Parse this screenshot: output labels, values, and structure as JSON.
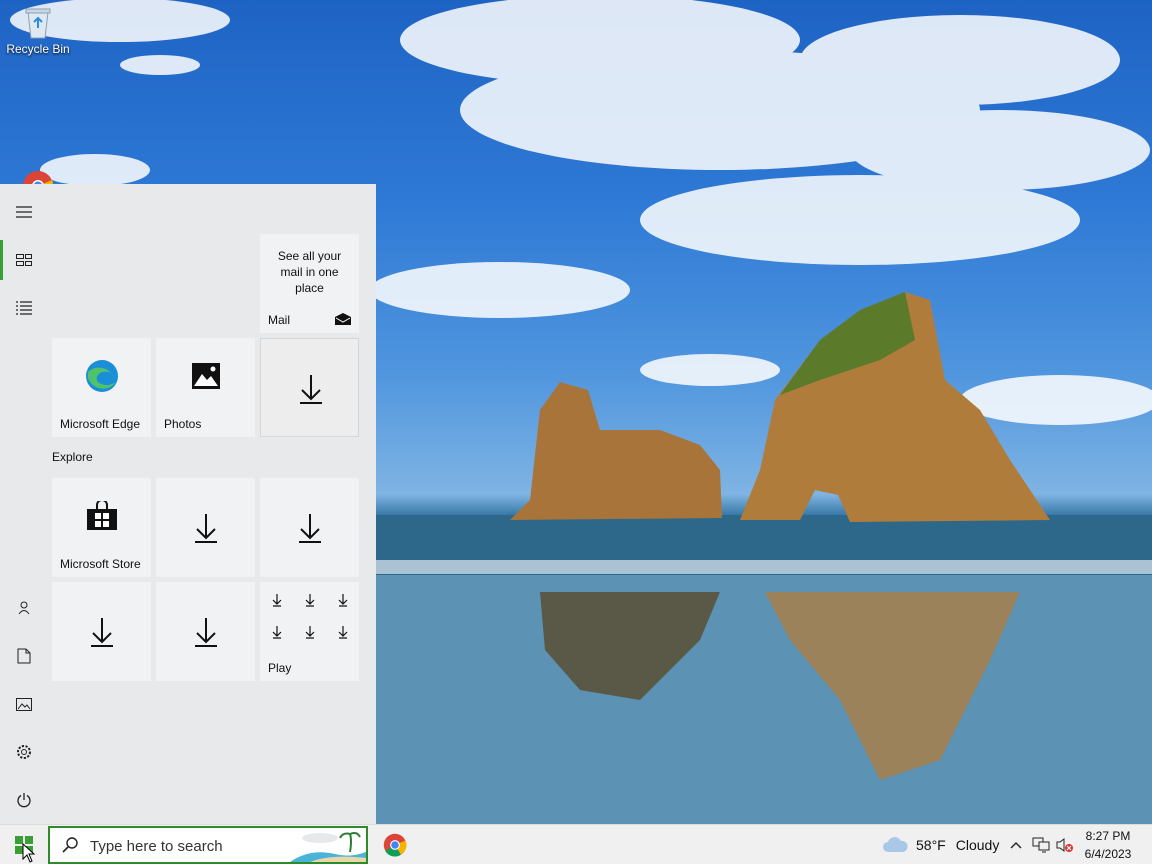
{
  "desktop": {
    "icons": [
      {
        "label": "Recycle Bin"
      }
    ]
  },
  "start_menu": {
    "tiles": {
      "mail": {
        "text": "See all your mail in one place",
        "label": "Mail"
      },
      "edge": {
        "label": "Microsoft Edge"
      },
      "photos": {
        "label": "Photos"
      },
      "store": {
        "label": "Microsoft Store"
      },
      "play": {
        "label": "Play"
      }
    },
    "group_label": "Explore"
  },
  "taskbar": {
    "search": {
      "placeholder": "Type here to search"
    },
    "weather": {
      "temp": "58°F",
      "condition": "Cloudy"
    },
    "clock": {
      "time": "8:27 PM",
      "date": "6/4/2023"
    }
  },
  "colors": {
    "accent": "#3aa036",
    "search_border": "#2f8a2c",
    "start_bg": "#e7e9ea",
    "tile_bg": "#f1f2f3"
  }
}
